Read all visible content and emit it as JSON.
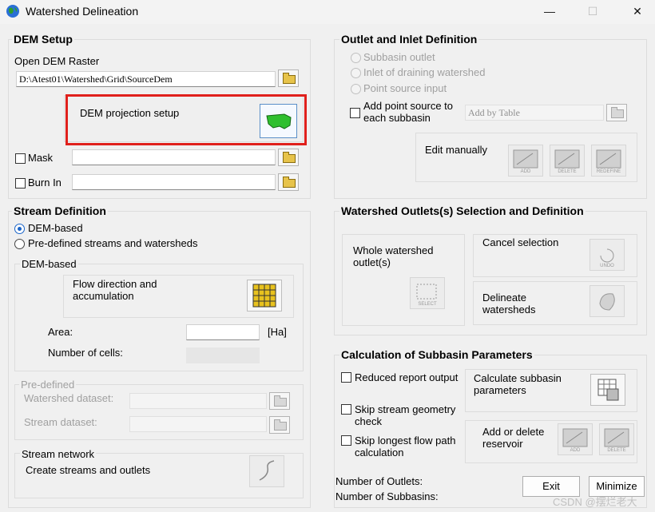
{
  "window": {
    "title": "Watershed Delineation",
    "minimize_glyph": "—",
    "maximize_glyph": "☐",
    "close_glyph": "✕"
  },
  "dem_setup": {
    "title": "DEM Setup",
    "open_label": "Open DEM Raster",
    "dem_path": "D:\\Atest01\\Watershed\\Grid\\SourceDem",
    "projection_label": "DEM projection setup",
    "mask_label": "Mask",
    "burnin_label": "Burn In"
  },
  "stream_def": {
    "title": "Stream Definition",
    "option_dem": "DEM-based",
    "option_predefined": "Pre-defined streams and watersheds",
    "dem_group_title": "DEM-based",
    "flow_label": "Flow direction and accumulation",
    "area_label": "Area:",
    "area_unit": "[Ha]",
    "cells_label": "Number of cells:",
    "predef_title": "Pre-defined",
    "watershed_dataset": "Watershed dataset:",
    "stream_dataset": "Stream dataset:",
    "network_title": "Stream network",
    "create_label": "Create streams and outlets"
  },
  "outlet_inlet": {
    "title": "Outlet and Inlet Definition",
    "subbasin_outlet": "Subbasin outlet",
    "inlet_watershed": "Inlet of draining watershed",
    "point_source": "Point source input",
    "add_point_source": "Add point source to each subbasin",
    "add_by_table": "Add by Table",
    "edit_manually": "Edit manually",
    "add_small": "ADD",
    "delete_small": "DELETE",
    "redefine_small": "REDEFINE"
  },
  "outlets_selection": {
    "title": "Watershed Outlets(s) Selection and Definition",
    "whole_outlet": "Whole watershed outlet(s)",
    "select_small": "SELECT",
    "cancel_selection": "Cancel selection",
    "undo_small": "UNDO",
    "delineate": "Delineate watersheds"
  },
  "subbasin_params": {
    "title": "Calculation of Subbasin Parameters",
    "reduced_report": "Reduced  report output",
    "skip_stream_check": "Skip stream geometry check",
    "skip_longest": "Skip longest flow path calculation",
    "calc_params": "Calculate subbasin parameters",
    "add_delete_reservoir": "Add or delete reservoir",
    "add_small": "ADD",
    "delete_small": "DELETE"
  },
  "footer": {
    "num_outlets": "Number of Outlets:",
    "num_subbasins": "Number of Subbasins:",
    "exit": "Exit",
    "minimize": "Minimize",
    "watermark": "CSDN @摆烂老大"
  }
}
